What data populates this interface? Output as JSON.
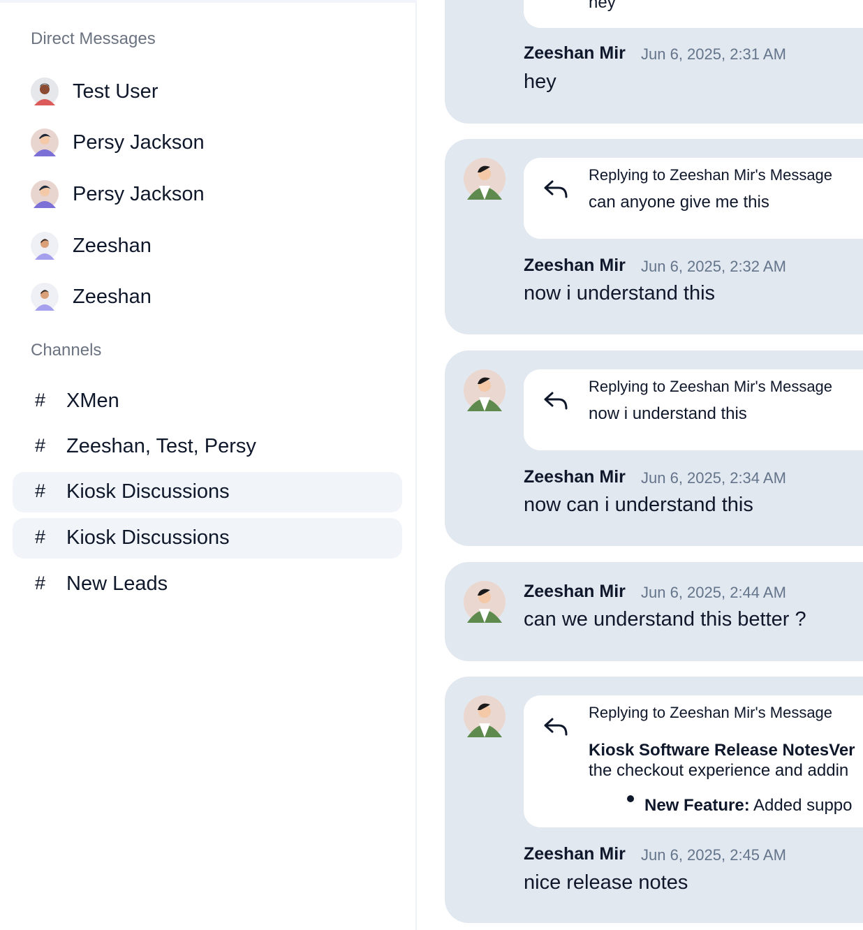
{
  "sidebar": {
    "direct_messages_title": "Direct Messages",
    "direct_messages": [
      {
        "name": "Test User",
        "avatar": "avatar-red-shirt"
      },
      {
        "name": "Persy Jackson",
        "avatar": "avatar-purple-shirt"
      },
      {
        "name": "Persy Jackson",
        "avatar": "avatar-purple-shirt"
      },
      {
        "name": "Zeeshan",
        "avatar": "avatar-lavender"
      },
      {
        "name": "Zeeshan",
        "avatar": "avatar-lavender"
      }
    ],
    "channels_title": "Channels",
    "channel_prefix": "#",
    "channels": [
      {
        "name": "XMen",
        "active": false
      },
      {
        "name": "Zeeshan, Test, Persy",
        "active": false
      },
      {
        "name": "Kiosk Discussions",
        "active": true
      },
      {
        "name": "Kiosk Discussions",
        "active": true
      },
      {
        "name": "New Leads",
        "active": false
      }
    ]
  },
  "messages": [
    {
      "author": "Zeeshan Mir",
      "timestamp": "Jun 6, 2025, 2:31 AM",
      "text": "hey",
      "reply_preview_partial": "hey"
    },
    {
      "author": "Zeeshan Mir",
      "timestamp": "Jun 6, 2025, 2:32 AM",
      "text": "now i understand this",
      "reply_heading": "Replying to Zeeshan Mir's Message",
      "reply_text": "can anyone give me this"
    },
    {
      "author": "Zeeshan Mir",
      "timestamp": "Jun 6, 2025, 2:34 AM",
      "text": "now can i understand this",
      "reply_heading": "Replying to Zeeshan Mir's Message",
      "reply_text": "now i understand this"
    },
    {
      "author": "Zeeshan Mir",
      "timestamp": "Jun 6, 2025, 2:44 AM",
      "text": "can we understand this better ?"
    },
    {
      "author": "Zeeshan Mir",
      "timestamp": "Jun 6, 2025, 2:45 AM",
      "text": "nice release notes",
      "reply_heading": "Replying to Zeeshan Mir's Message",
      "reply_title": "Kiosk Software Release NotesVer",
      "reply_body": "the checkout experience and addin",
      "reply_bullet_label": "New Feature:",
      "reply_bullet_text": " Added suppo"
    }
  ],
  "colors": {
    "card_background": "#e2e8f0",
    "active_channel_background": "#f1f5f9",
    "muted_text": "#6b7280",
    "timestamp_text": "#64748b"
  }
}
